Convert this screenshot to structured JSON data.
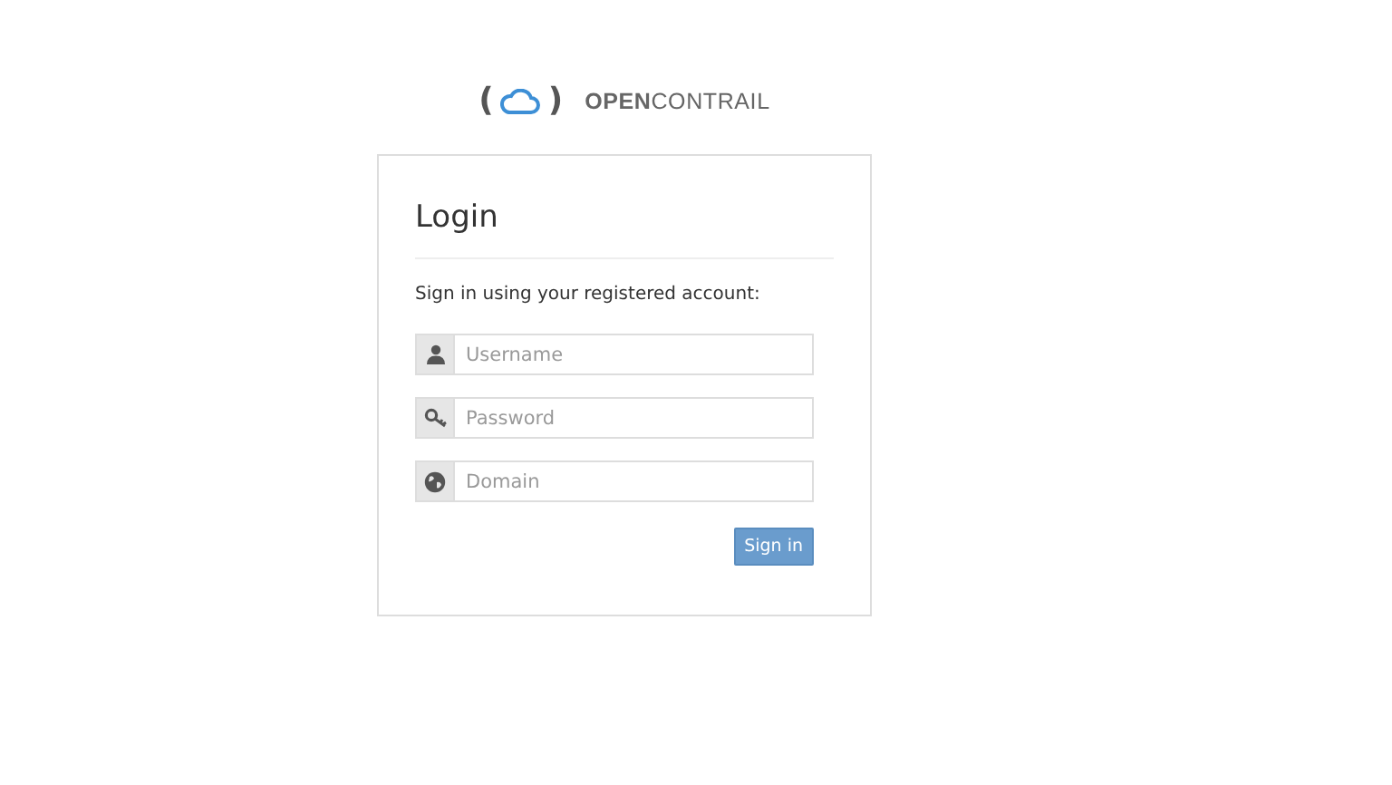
{
  "logo": {
    "open_bracket": "(",
    "close_bracket": ")",
    "name": "**OPEN**CONTRAIL"
  },
  "login": {
    "title": "Login",
    "subtitle": "Sign in using your registered account:",
    "fields": [
      {
        "kind": "username",
        "placeholder": "Username"
      },
      {
        "kind": "password",
        "placeholder": "Password"
      },
      {
        "kind": "domain",
        "placeholder": "Domain"
      }
    ],
    "submit": "Sign in"
  }
}
